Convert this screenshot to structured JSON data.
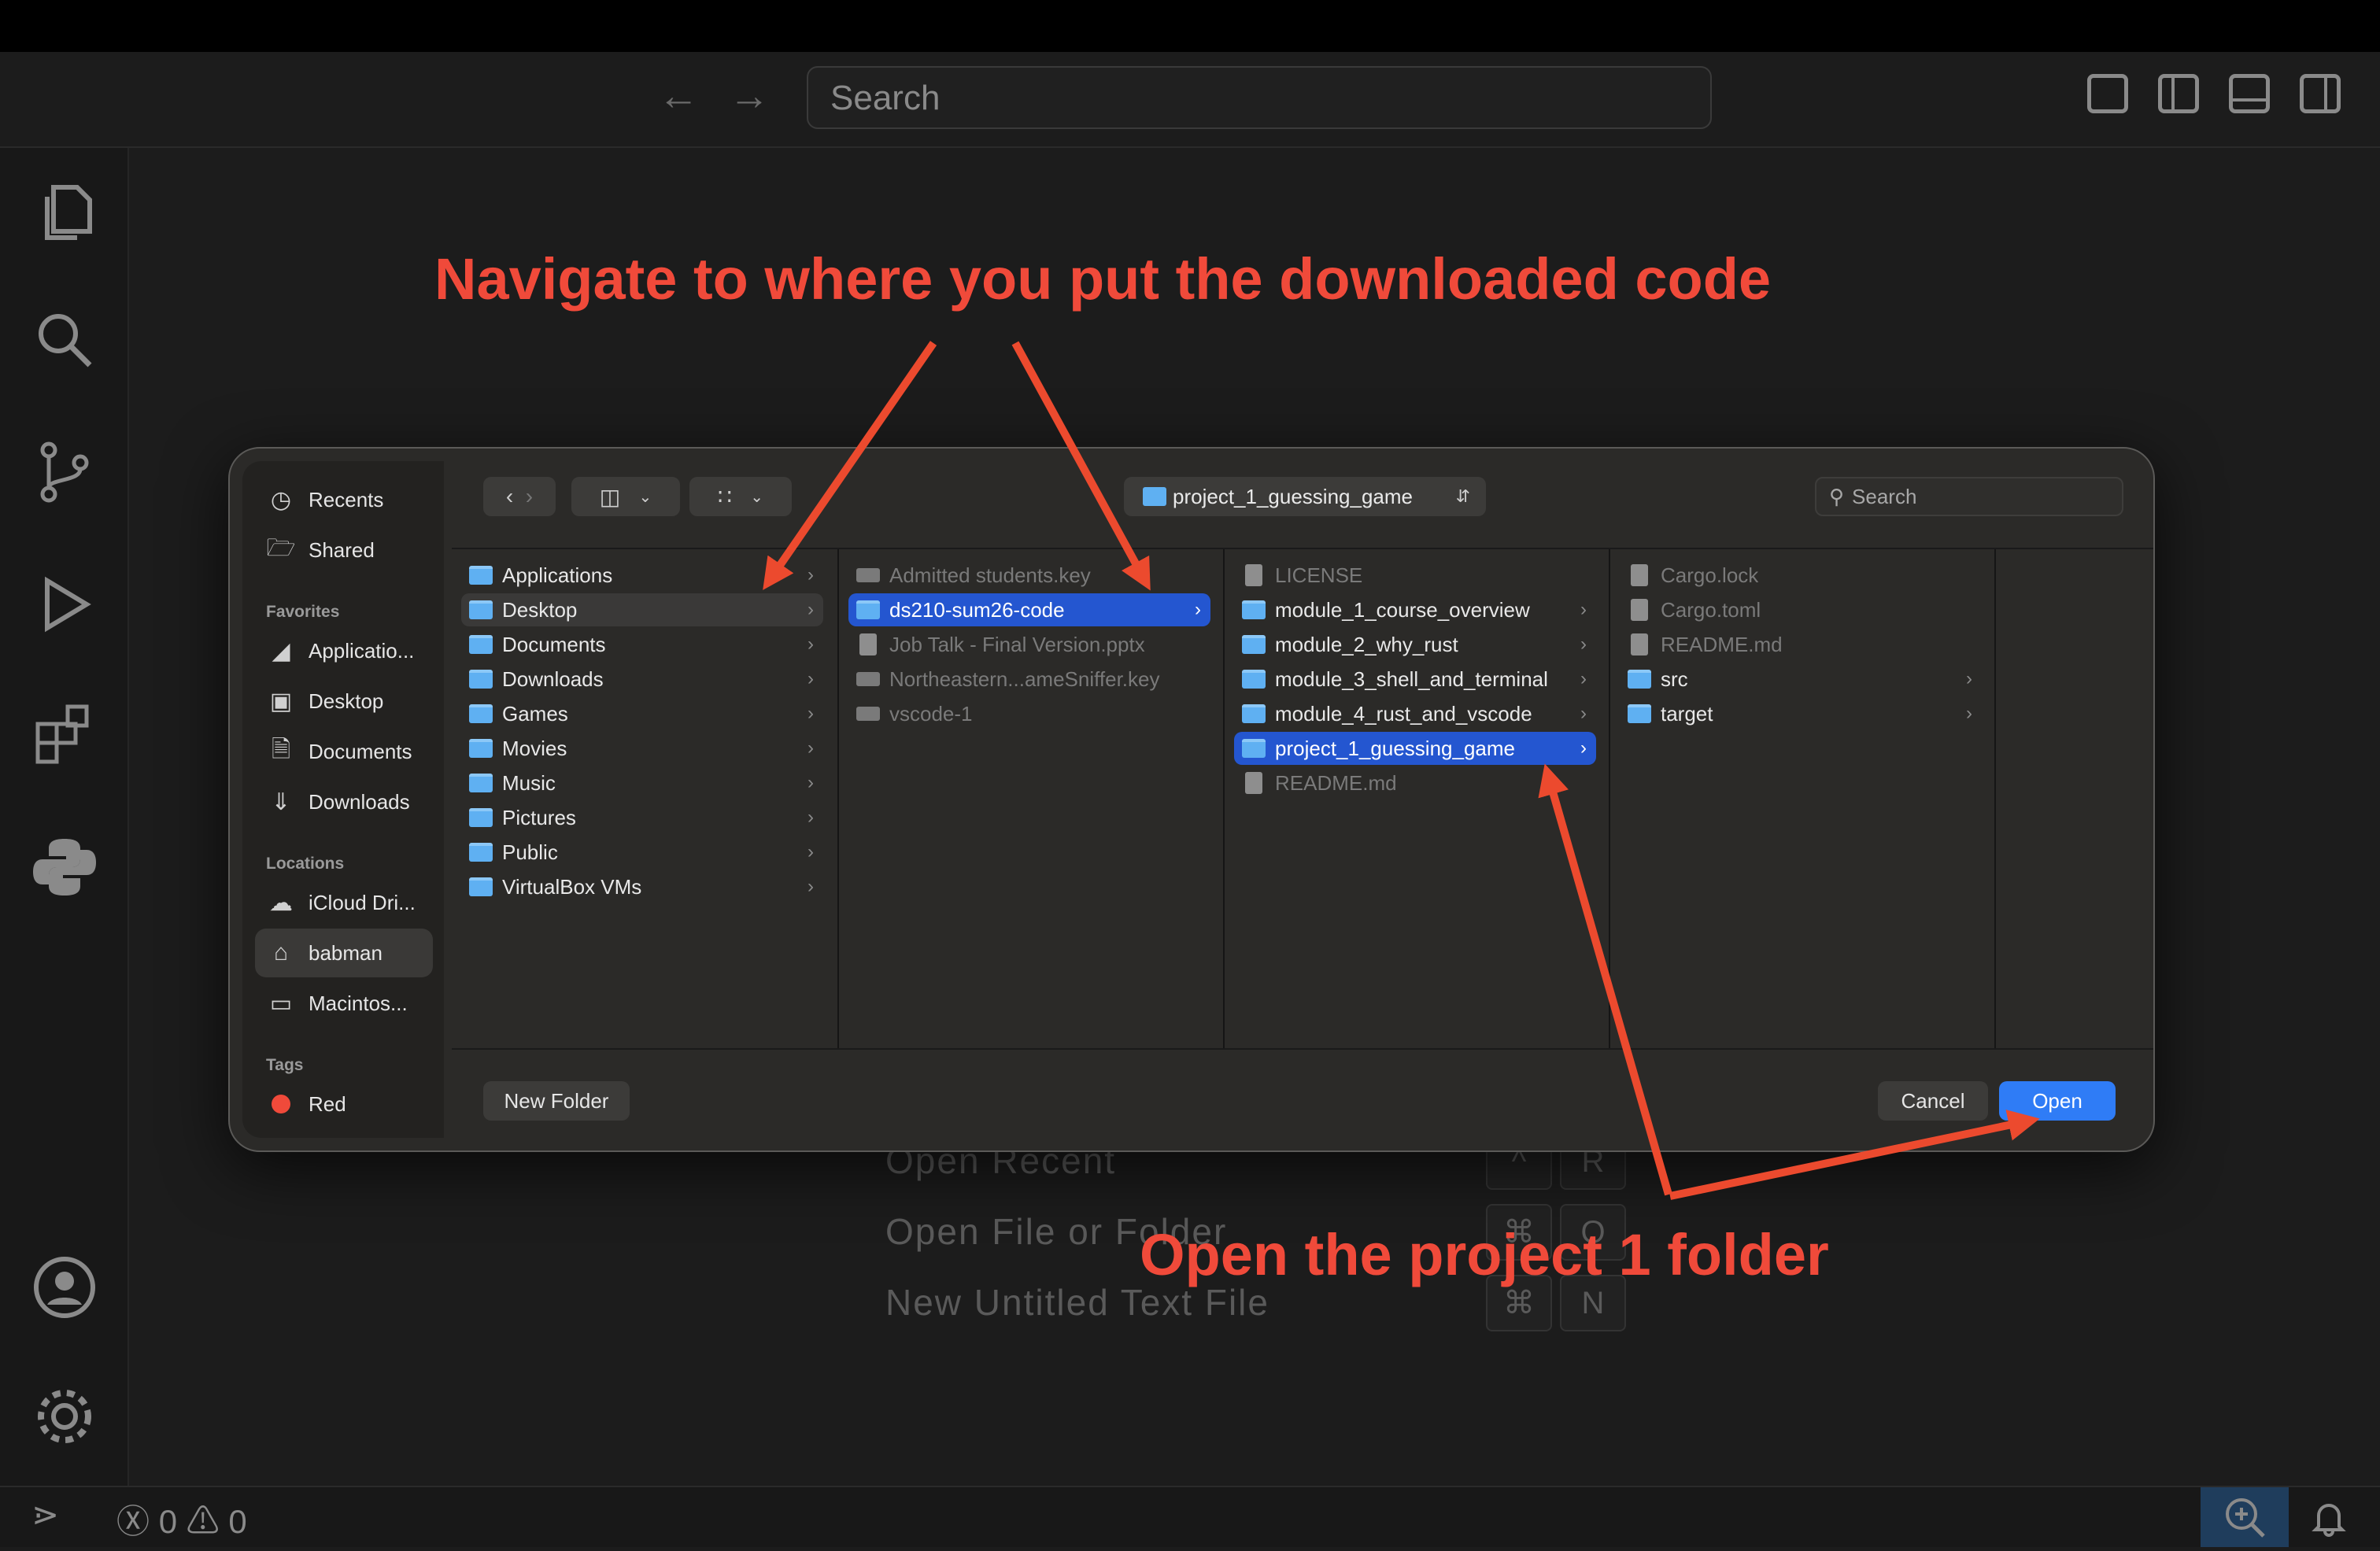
{
  "search": {
    "placeholder": "Search"
  },
  "welcome": {
    "rows": [
      {
        "label": "Open Recent",
        "keys": [
          "^",
          "R"
        ]
      },
      {
        "label": "Open File or Folder",
        "keys": [
          "⌘",
          "O"
        ]
      },
      {
        "label": "New Untitled Text File",
        "keys": [
          "⌘",
          "N"
        ]
      }
    ]
  },
  "statusbar": {
    "errors": "0",
    "warnings": "0"
  },
  "dialog": {
    "path": "project_1_guessing_game",
    "search_placeholder": "Search",
    "sidebar": {
      "recents": "Recents",
      "shared": "Shared",
      "favorites_header": "Favorites",
      "favorites": [
        "Applicatio...",
        "Desktop",
        "Documents",
        "Downloads"
      ],
      "locations_header": "Locations",
      "locations": [
        "iCloud Dri...",
        "babman",
        "Macintos..."
      ],
      "tags_header": "Tags",
      "tags": [
        "Red"
      ]
    },
    "columns": [
      {
        "items": [
          {
            "name": "Applications",
            "type": "folder",
            "state": ""
          },
          {
            "name": "Desktop",
            "type": "folder",
            "state": "hl"
          },
          {
            "name": "Documents",
            "type": "folder",
            "state": ""
          },
          {
            "name": "Downloads",
            "type": "folder",
            "state": ""
          },
          {
            "name": "Games",
            "type": "folder",
            "state": ""
          },
          {
            "name": "Movies",
            "type": "folder",
            "state": ""
          },
          {
            "name": "Music",
            "type": "folder",
            "state": ""
          },
          {
            "name": "Pictures",
            "type": "folder",
            "state": ""
          },
          {
            "name": "Public",
            "type": "folder",
            "state": ""
          },
          {
            "name": "VirtualBox VMs",
            "type": "folder",
            "state": ""
          }
        ]
      },
      {
        "items": [
          {
            "name": "Admitted students.key",
            "type": "key",
            "state": "dim"
          },
          {
            "name": "ds210-sum26-code",
            "type": "folder",
            "state": "sel"
          },
          {
            "name": "Job Talk - Final Version.pptx",
            "type": "file",
            "state": "dim"
          },
          {
            "name": "Northeastern...ameSniffer.key",
            "type": "key",
            "state": "dim"
          },
          {
            "name": "vscode-1",
            "type": "key",
            "state": "dim"
          }
        ]
      },
      {
        "items": [
          {
            "name": "LICENSE",
            "type": "file",
            "state": "dim"
          },
          {
            "name": "module_1_course_overview",
            "type": "folder",
            "state": ""
          },
          {
            "name": "module_2_why_rust",
            "type": "folder",
            "state": ""
          },
          {
            "name": "module_3_shell_and_terminal",
            "type": "folder",
            "state": ""
          },
          {
            "name": "module_4_rust_and_vscode",
            "type": "folder",
            "state": ""
          },
          {
            "name": "project_1_guessing_game",
            "type": "folder",
            "state": "sel"
          },
          {
            "name": "README.md",
            "type": "file",
            "state": "dim"
          }
        ]
      },
      {
        "items": [
          {
            "name": "Cargo.lock",
            "type": "file",
            "state": "dim"
          },
          {
            "name": "Cargo.toml",
            "type": "file",
            "state": "dim"
          },
          {
            "name": "README.md",
            "type": "file",
            "state": "dim"
          },
          {
            "name": "src",
            "type": "folder",
            "state": ""
          },
          {
            "name": "target",
            "type": "folder",
            "state": ""
          }
        ]
      }
    ],
    "new_folder": "New Folder",
    "cancel": "Cancel",
    "open": "Open"
  },
  "annotations": {
    "top": "Navigate to where you put the downloaded code",
    "bottom": "Open the project 1 folder",
    "color": "#f04a3a"
  },
  "colors": {
    "selection": "#2456d0",
    "open_button": "#2f7cf6",
    "folder": "#5fb0f2",
    "tag_red": "#f04a3a"
  }
}
